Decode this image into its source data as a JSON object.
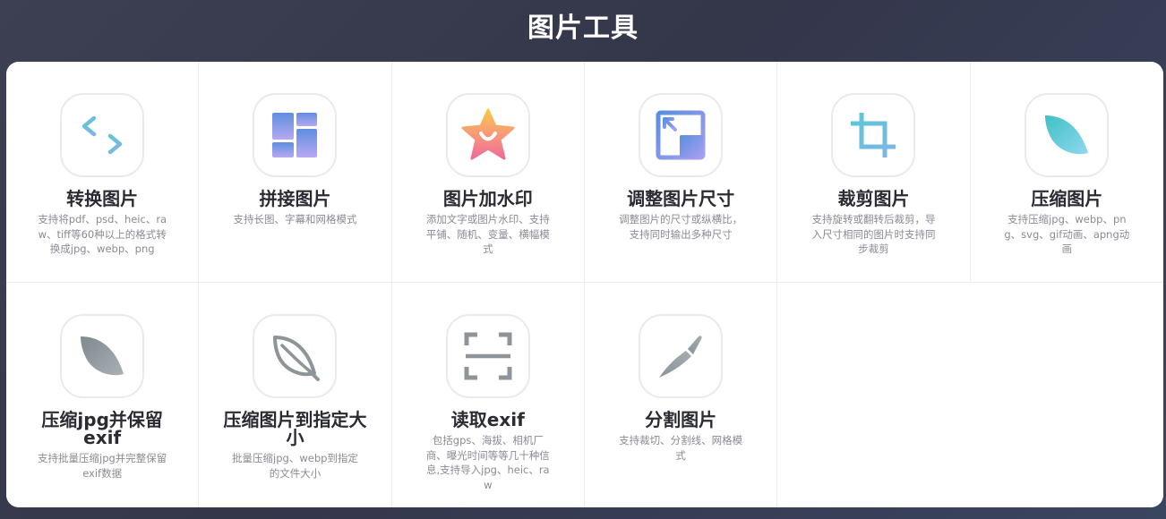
{
  "page": {
    "title": "图片工具"
  },
  "tools": [
    {
      "title": "转换图片",
      "desc": "支持将pdf、psd、heic、raw、tiff等60种以上的格式转换成jpg、webp、png",
      "icon": "convert-arrows-icon"
    },
    {
      "title": "拼接图片",
      "desc": "支持长图、字幕和网格模式",
      "icon": "grid-layout-icon"
    },
    {
      "title": "图片加水印",
      "desc": "添加文字或图片水印、支持平铺、随机、变量、横幅模式",
      "icon": "star-watermark-icon"
    },
    {
      "title": "调整图片尺寸",
      "desc": "调整图片的尺寸或纵横比，支持同时输出多种尺寸",
      "icon": "resize-icon"
    },
    {
      "title": "裁剪图片",
      "desc": "支持旋转或翻转后裁剪，导入尺寸相同的图片时支持同步裁剪",
      "icon": "crop-icon"
    },
    {
      "title": "压缩图片",
      "desc": "支持压缩jpg、webp、png、svg、gif动画、apng动画",
      "icon": "leaf-icon"
    },
    {
      "title": "压缩jpg并保留exif",
      "desc": "支持批量压缩jpg并完整保留exif数据",
      "icon": "leaf-gray-icon"
    },
    {
      "title": "压缩图片到指定大小",
      "desc": "批量压缩jpg、webp到指定的文件大小",
      "icon": "leaf-outline-icon"
    },
    {
      "title": "读取exif",
      "desc": "包括gps、海拔、相机厂商、曝光时间等等几十种信息,支持导入jpg、heic、raw",
      "icon": "scan-icon"
    },
    {
      "title": "分割图片",
      "desc": "支持裁切、分割线、网格模式",
      "icon": "knife-icon"
    }
  ],
  "colors": {
    "accent_teal": "#6cc8d8",
    "accent_blue": "#6b8fe3",
    "accent_purple": "#a99ff0",
    "icon_gray": "#8d9599",
    "title_text": "#2b2c33",
    "desc_text": "#8a8a94"
  }
}
